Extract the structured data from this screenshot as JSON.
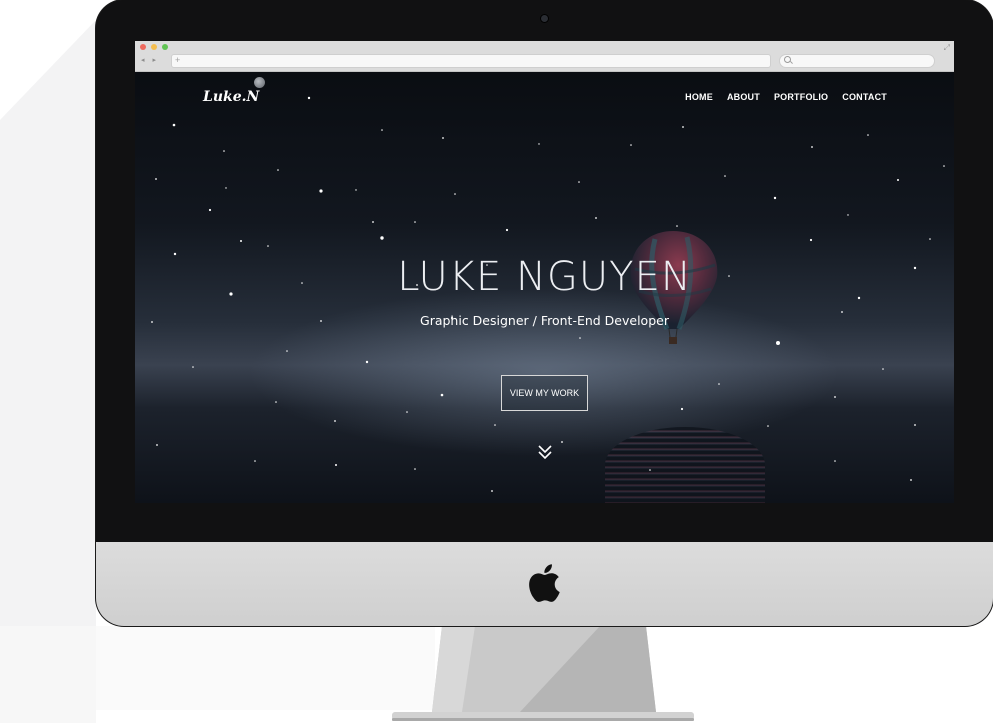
{
  "browser": {
    "url": "",
    "search_placeholder": ""
  },
  "site": {
    "logo": "Luke.N",
    "nav": [
      "HOME",
      "ABOUT",
      "PORTFOLIO",
      "CONTACT"
    ],
    "hero_title": "LUKE NGUYEN",
    "hero_subtitle": "Graphic Designer / Front-End Developer",
    "cta_label": "VIEW MY WORK"
  },
  "icons": {
    "logo_decoration": "moon-icon",
    "scroll": "double-chevron-down-icon",
    "hardware_logo": "apple-logo-icon",
    "hero_image": "hot-air-balloon"
  },
  "colors": {
    "bezel": "#111112",
    "chin": "#d6d6d6",
    "hero_text": "#ffffff"
  }
}
